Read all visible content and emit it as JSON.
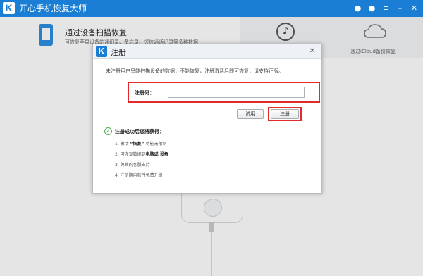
{
  "app": {
    "title": "开心手机恢复大师"
  },
  "titlebar_icons": [
    {
      "name": "wechat-icon",
      "glyph": "●"
    },
    {
      "name": "chat-icon",
      "glyph": "●"
    },
    {
      "name": "menu-icon",
      "glyph": "≡"
    },
    {
      "name": "minimize-icon",
      "glyph": "–"
    },
    {
      "name": "close-icon",
      "glyph": "✕"
    }
  ],
  "tabs": {
    "device": {
      "title": "通过设备扫描恢复",
      "subtitle": "可恢复苹果设备的通讯录、备忘录、短信通话记录等多种数据"
    },
    "itunes": {
      "icon": "music-note-icon"
    },
    "icloud": {
      "label": "通过iCloud备份恢复",
      "icon": "cloud-icon"
    }
  },
  "dialog": {
    "title": "注册",
    "close_glyph": "✕",
    "note": "未注册用户只能扫描设备的数据，不能恢复，注册激活后即可恢复，请支持正版。",
    "reg_code_label": "注册码：",
    "reg_code_value": "",
    "trial_button": "试用",
    "register_button": "注册",
    "benefits_title": "注册成功后您将获得：",
    "benefits": [
      {
        "prefix": "1. 激活 ",
        "bold": "“恢复”",
        "suffix": " 功能无限制"
      },
      {
        "prefix": "2. 可恢复数据到",
        "bold": "电脑或 设备",
        "suffix": ""
      },
      {
        "prefix": "3. 免费的客服支持",
        "bold": "",
        "suffix": ""
      },
      {
        "prefix": "4. 注册期内软件免费升级",
        "bold": "",
        "suffix": ""
      }
    ]
  },
  "colors": {
    "titlebar": "#1a7fd4",
    "highlight": "#e32a2a",
    "success": "#4caf50"
  }
}
